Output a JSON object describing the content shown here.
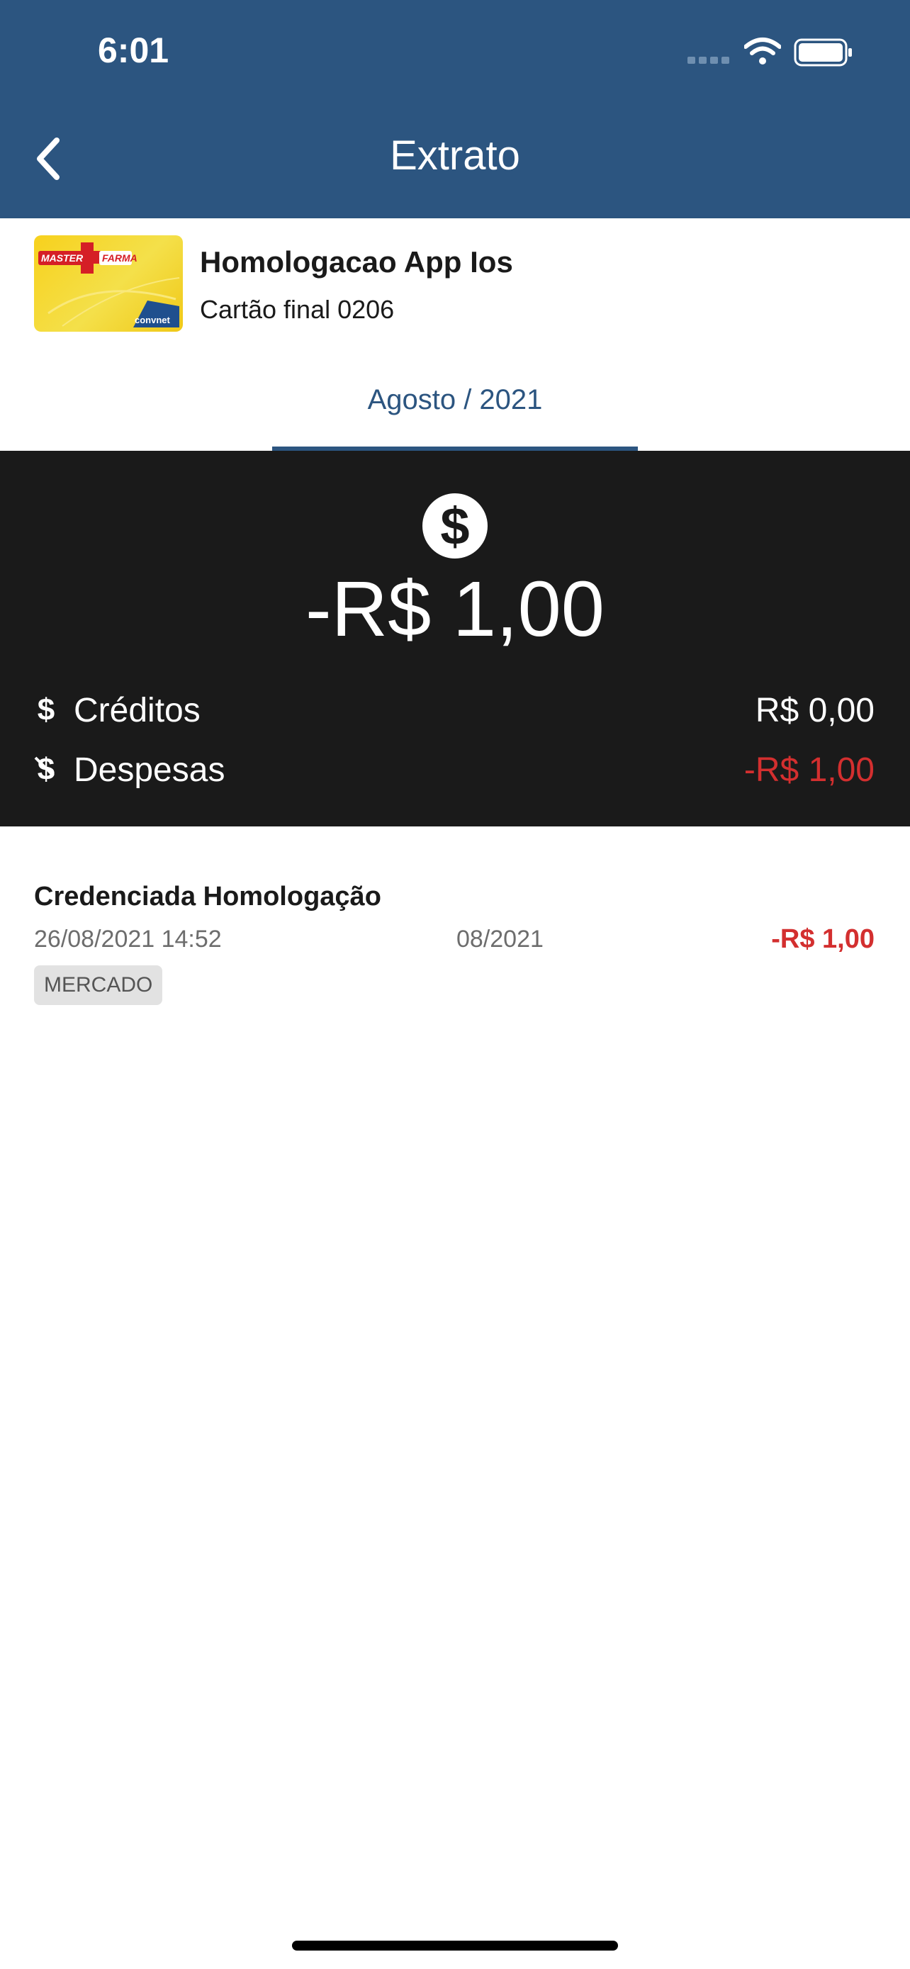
{
  "status_bar": {
    "time": "6:01"
  },
  "header": {
    "title": "Extrato"
  },
  "card": {
    "name": "Homologacao App Ios",
    "subtitle": "Cartão final 0206",
    "logo_text": "MASTER",
    "logo_text2": "FARMA",
    "brand_text": "convnet"
  },
  "tab": {
    "label": "Agosto / 2021"
  },
  "summary": {
    "total": "-R$  1,00",
    "credits_label": "Créditos",
    "credits_value": "R$  0,00",
    "expenses_label": "Despesas",
    "expenses_value": "-R$  1,00"
  },
  "transactions": [
    {
      "name": "Credenciada Homologação",
      "datetime": "26/08/2021 14:52",
      "reference": "08/2021",
      "amount": "-R$  1,00",
      "category": "MERCADO"
    }
  ],
  "colors": {
    "header": "#2c5580",
    "summary_bg": "#1a1a1a",
    "negative": "#d32f2f",
    "tag_bg": "#e2e2e2"
  }
}
